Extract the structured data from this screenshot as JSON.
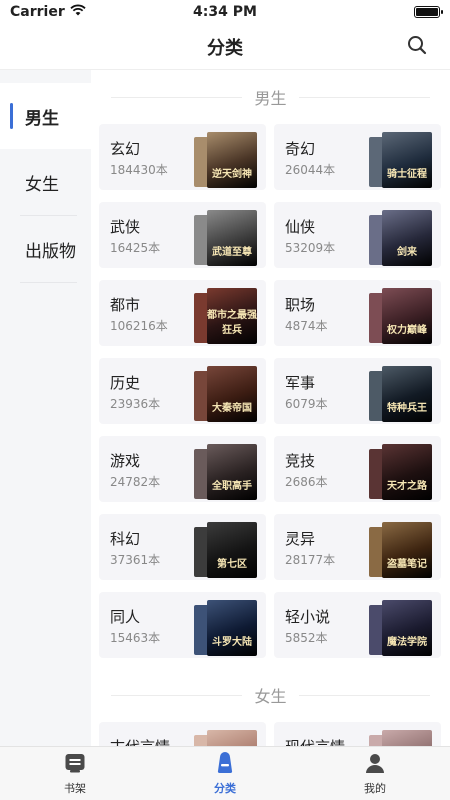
{
  "status_bar": {
    "carrier": "Carrier",
    "time": "4:34 PM",
    "icons": [
      "wifi-icon",
      "battery-icon"
    ]
  },
  "nav": {
    "title": "分类",
    "search_icon": "search-icon"
  },
  "sidebar": {
    "items": [
      {
        "label": "男生",
        "active": true
      },
      {
        "label": "女生",
        "active": false
      },
      {
        "label": "出版物",
        "active": false
      }
    ]
  },
  "sections": [
    {
      "title": "男生",
      "categories": [
        {
          "name": "玄幻",
          "count": "184430本",
          "cover_text": "逆天剑神",
          "cover_color": "#4a3526",
          "back_color": "#a88d6c"
        },
        {
          "name": "奇幻",
          "count": "26044本",
          "cover_text": "骑士征程",
          "cover_color": "#1f2c3d",
          "back_color": "#5c6877"
        },
        {
          "name": "武侠",
          "count": "16425本",
          "cover_text": "武道至尊",
          "cover_color": "#3d3d3d",
          "back_color": "#8a8a8a"
        },
        {
          "name": "仙侠",
          "count": "53209本",
          "cover_text": "剑来",
          "cover_color": "#26283a",
          "back_color": "#6a6e88"
        },
        {
          "name": "都市",
          "count": "106216本",
          "cover_text": "都市之最强狂兵",
          "cover_color": "#2a1414",
          "back_color": "#7a3a2f"
        },
        {
          "name": "职场",
          "count": "4874本",
          "cover_text": "权力巅峰",
          "cover_color": "#3b1f24",
          "back_color": "#7d4d54"
        },
        {
          "name": "历史",
          "count": "23936本",
          "cover_text": "大秦帝国",
          "cover_color": "#3b1c12",
          "back_color": "#77463a"
        },
        {
          "name": "军事",
          "count": "6079本",
          "cover_text": "特种兵王",
          "cover_color": "#121a24",
          "back_color": "#4d5a66"
        },
        {
          "name": "游戏",
          "count": "24782本",
          "cover_text": "全职高手",
          "cover_color": "#2a2222",
          "back_color": "#6a5b5b"
        },
        {
          "name": "竞技",
          "count": "2686本",
          "cover_text": "天才之路",
          "cover_color": "#1e1010",
          "back_color": "#5a3434"
        },
        {
          "name": "科幻",
          "count": "37361本",
          "cover_text": "第七区",
          "cover_color": "#141414",
          "back_color": "#3c3c3c"
        },
        {
          "name": "灵异",
          "count": "28177本",
          "cover_text": "盗墓笔记",
          "cover_color": "#3d2410",
          "back_color": "#8a6a44"
        },
        {
          "name": "同人",
          "count": "15463本",
          "cover_text": "斗罗大陆",
          "cover_color": "#0e1a33",
          "back_color": "#3d5277"
        },
        {
          "name": "轻小说",
          "count": "5852本",
          "cover_text": "魔法学院",
          "cover_color": "#1a1a2e",
          "back_color": "#4b4b6b"
        }
      ]
    },
    {
      "title": "女生",
      "categories": [
        {
          "name": "古代言情",
          "count": "",
          "cover_text": "",
          "cover_color": "#a8786a",
          "back_color": "#d8b7a8"
        },
        {
          "name": "现代言情",
          "count": "",
          "cover_text": "",
          "cover_color": "#8a6a6a",
          "back_color": "#c9aaaa"
        }
      ]
    }
  ],
  "tabs": [
    {
      "label": "书架",
      "icon": "bookshelf-icon",
      "active": false
    },
    {
      "label": "分类",
      "icon": "category-icon",
      "active": true
    },
    {
      "label": "我的",
      "icon": "profile-icon",
      "active": false
    }
  ],
  "colors": {
    "accent": "#3b6fd6",
    "card_bg": "#f5f5f8",
    "sidebar_bg": "#f5f6f8"
  }
}
